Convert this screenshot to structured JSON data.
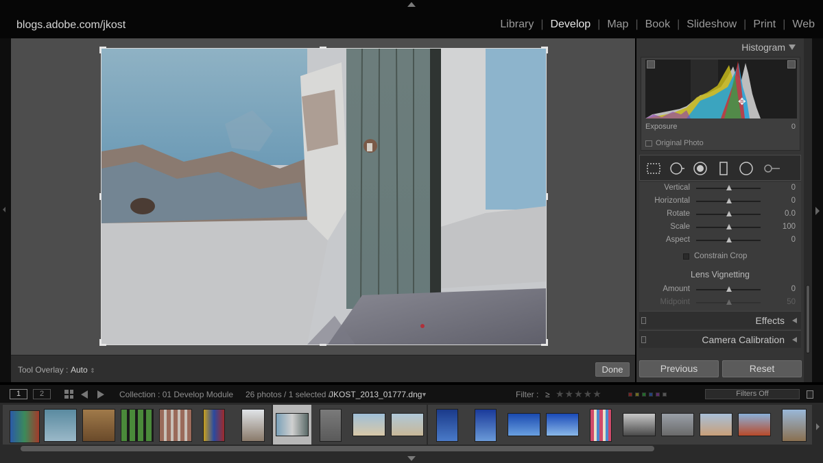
{
  "identity": {
    "text": "blogs.adobe.com/jkost"
  },
  "modules": [
    {
      "label": "Library",
      "active": false
    },
    {
      "label": "Develop",
      "active": true
    },
    {
      "label": "Map",
      "active": false
    },
    {
      "label": "Book",
      "active": false
    },
    {
      "label": "Slideshow",
      "active": false
    },
    {
      "label": "Print",
      "active": false
    },
    {
      "label": "Web",
      "active": false
    }
  ],
  "toolbar": {
    "tool_overlay_label": "Tool Overlay :",
    "tool_overlay_value": "Auto",
    "done_label": "Done"
  },
  "histogram": {
    "title": "Histogram",
    "info_label": "Exposure",
    "info_value": "0",
    "original_photo_label": "Original Photo"
  },
  "tools": [
    "crop-overlay-icon",
    "spot-removal-icon",
    "red-eye-icon",
    "graduated-filter-icon",
    "radial-filter-icon",
    "adjustment-brush-icon"
  ],
  "transform": {
    "rows": [
      {
        "label": "Vertical",
        "value": "0"
      },
      {
        "label": "Horizontal",
        "value": "0"
      },
      {
        "label": "Rotate",
        "value": "0.0"
      },
      {
        "label": "Scale",
        "value": "100"
      },
      {
        "label": "Aspect",
        "value": "0"
      }
    ],
    "constrain_label": "Constrain Crop"
  },
  "lens_vignetting": {
    "title": "Lens Vignetting",
    "rows": [
      {
        "label": "Amount",
        "value": "0"
      },
      {
        "label": "Midpoint",
        "value": "50"
      }
    ]
  },
  "sections": {
    "effects": "Effects",
    "camera_calibration": "Camera Calibration"
  },
  "panel_buttons": {
    "previous": "Previous",
    "reset": "Reset"
  },
  "filmbar": {
    "monitor1": "1",
    "monitor2": "2",
    "collection": "Collection : 01 Develop Module",
    "count": "26 photos / 1 selected /",
    "filename": "JKOST_2013_01777.dng",
    "filter_label": "Filter :",
    "rating_op": "≥",
    "filter_select": "Filters Off"
  },
  "colors": {
    "accent_red": "#c03030",
    "label_green": "#2f7a2f",
    "label_blue": "#2c4fa8",
    "label_yellow": "#a8a02c",
    "label_purple": "#6a2c8a"
  }
}
